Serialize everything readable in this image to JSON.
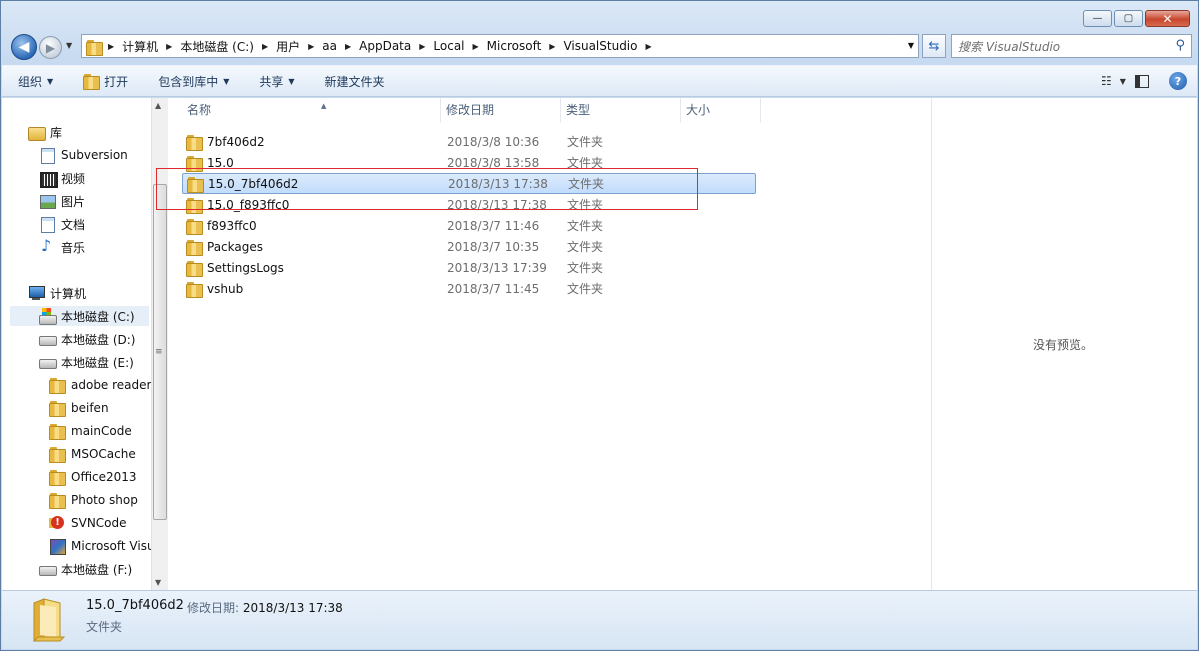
{
  "window": {
    "minimize": "—",
    "maximize": "▢",
    "close": "✕"
  },
  "nav": {
    "back": "◀",
    "forward": "▶",
    "breadcrumb": [
      "计算机",
      "本地磁盘 (C:)",
      "用户",
      "aa",
      "AppData",
      "Local",
      "Microsoft",
      "VisualStudio"
    ],
    "search_placeholder": "搜索 VisualStudio",
    "search_icon": "magnifier-icon",
    "refresh_icon": "refresh-icon"
  },
  "toolbar": {
    "organize": "组织",
    "open": "打开",
    "include_in_library": "包含到库中",
    "share": "共享",
    "new_folder": "新建文件夹"
  },
  "sidebar": {
    "items": [
      {
        "label": "库",
        "icon": "library-icon"
      },
      {
        "label": "Subversion",
        "icon": "document-icon"
      },
      {
        "label": "视频",
        "icon": "video-icon"
      },
      {
        "label": "图片",
        "icon": "picture-icon"
      },
      {
        "label": "文档",
        "icon": "document-icon"
      },
      {
        "label": "音乐",
        "icon": "music-icon"
      },
      {
        "label": "计算机",
        "icon": "computer-icon"
      },
      {
        "label": "本地磁盘 (C:)",
        "icon": "drive-c-icon"
      },
      {
        "label": "本地磁盘 (D:)",
        "icon": "drive-icon"
      },
      {
        "label": "本地磁盘 (E:)",
        "icon": "drive-icon"
      },
      {
        "label": "adobe reader",
        "icon": "folder-icon"
      },
      {
        "label": "beifen",
        "icon": "folder-icon"
      },
      {
        "label": "mainCode",
        "icon": "folder-icon"
      },
      {
        "label": "MSOCache",
        "icon": "folder-icon"
      },
      {
        "label": "Office2013",
        "icon": "folder-icon"
      },
      {
        "label": "Photo shop",
        "icon": "folder-icon"
      },
      {
        "label": "SVNCode",
        "icon": "svn-folder-icon"
      },
      {
        "label": "Microsoft Visu",
        "icon": "visual-studio-icon"
      },
      {
        "label": "本地磁盘 (F:)",
        "icon": "drive-icon"
      }
    ]
  },
  "columns": {
    "name": "名称",
    "date": "修改日期",
    "type": "类型",
    "size": "大小"
  },
  "files": [
    {
      "name": "7bf406d2",
      "date": "2018/3/8 10:36",
      "type": "文件夹"
    },
    {
      "name": "15.0",
      "date": "2018/3/8 13:58",
      "type": "文件夹"
    },
    {
      "name": "15.0_7bf406d2",
      "date": "2018/3/13 17:38",
      "type": "文件夹"
    },
    {
      "name": "15.0_f893ffc0",
      "date": "2018/3/13 17:38",
      "type": "文件夹"
    },
    {
      "name": "f893ffc0",
      "date": "2018/3/7 11:46",
      "type": "文件夹"
    },
    {
      "name": "Packages",
      "date": "2018/3/7 10:35",
      "type": "文件夹"
    },
    {
      "name": "SettingsLogs",
      "date": "2018/3/13 17:39",
      "type": "文件夹"
    },
    {
      "name": "vshub",
      "date": "2018/3/7 11:45",
      "type": "文件夹"
    }
  ],
  "preview": {
    "message": "没有预览。"
  },
  "details": {
    "name": "15.0_7bf406d2",
    "modified_label": "修改日期:",
    "modified_value": "2018/3/13 17:38",
    "type": "文件夹"
  }
}
